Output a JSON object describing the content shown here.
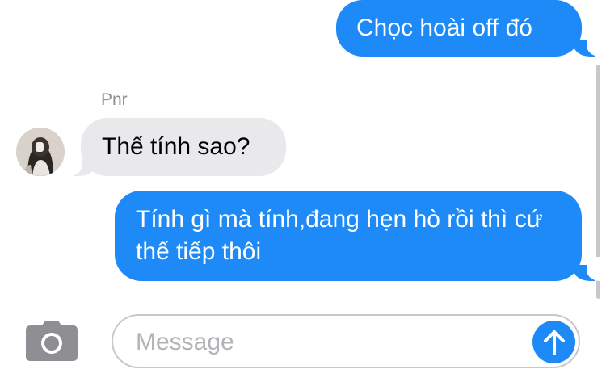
{
  "conversation": {
    "messages": [
      {
        "direction": "sent",
        "text": "Chọc hoài off đó"
      },
      {
        "direction": "received",
        "sender": "Pnr",
        "text": "Thế tính sao?"
      },
      {
        "direction": "sent",
        "text": "Tính gì mà tính,đang hẹn hò rồi thì cứ thế tiếp thôi"
      }
    ]
  },
  "composer": {
    "placeholder": "Message",
    "value": "",
    "camera_icon": "camera-icon",
    "send_icon": "arrow-up-icon"
  },
  "colors": {
    "sent_bubble": "#1e8af7",
    "received_bubble": "#e9e9eb",
    "sender_name": "#8e8e93",
    "placeholder": "#b3b3b8"
  }
}
